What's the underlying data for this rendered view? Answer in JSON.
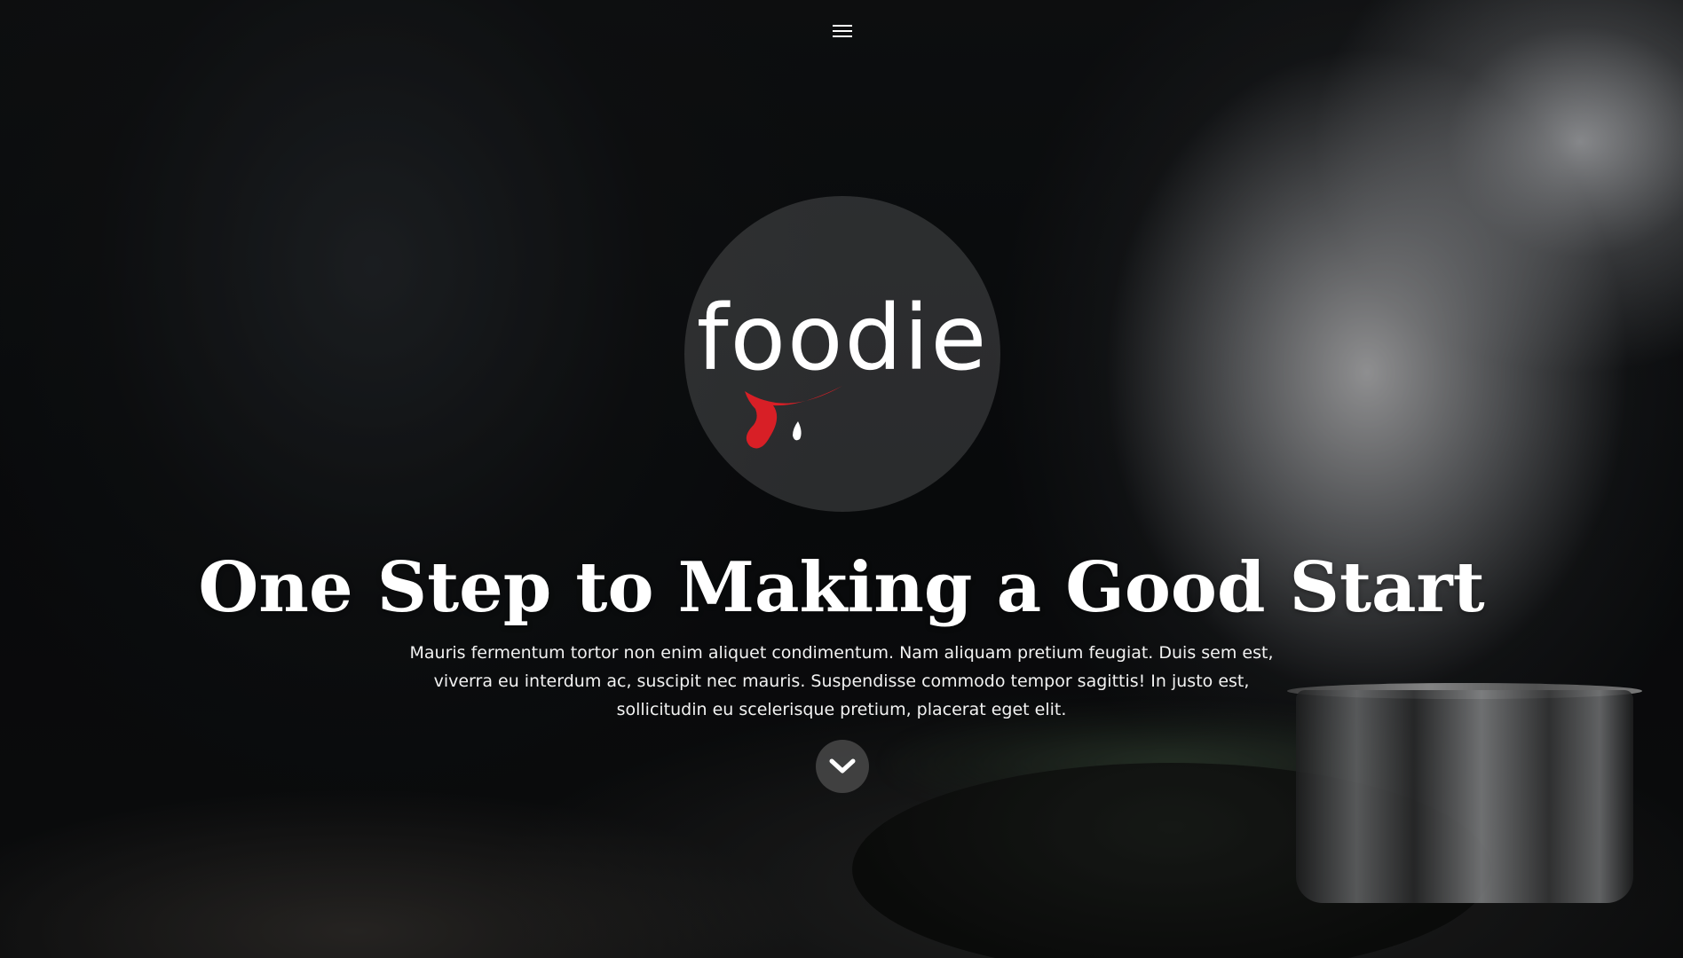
{
  "header": {
    "menu_icon": "hamburger-menu-icon"
  },
  "logo": {
    "text": "foodie",
    "accent_color": "#d81f26"
  },
  "hero": {
    "headline": "One Step to Making a Good Start",
    "description": "Mauris fermentum tortor non enim aliquet condimentum. Nam aliquam pretium feugiat. Duis sem est, viverra eu interdum ac, suscipit nec mauris. Suspendisse commodo tempor sagittis! In justo est, sollicitudin eu scelerisque pretium, placerat eget elit.",
    "scroll_icon": "chevron-down-icon"
  }
}
